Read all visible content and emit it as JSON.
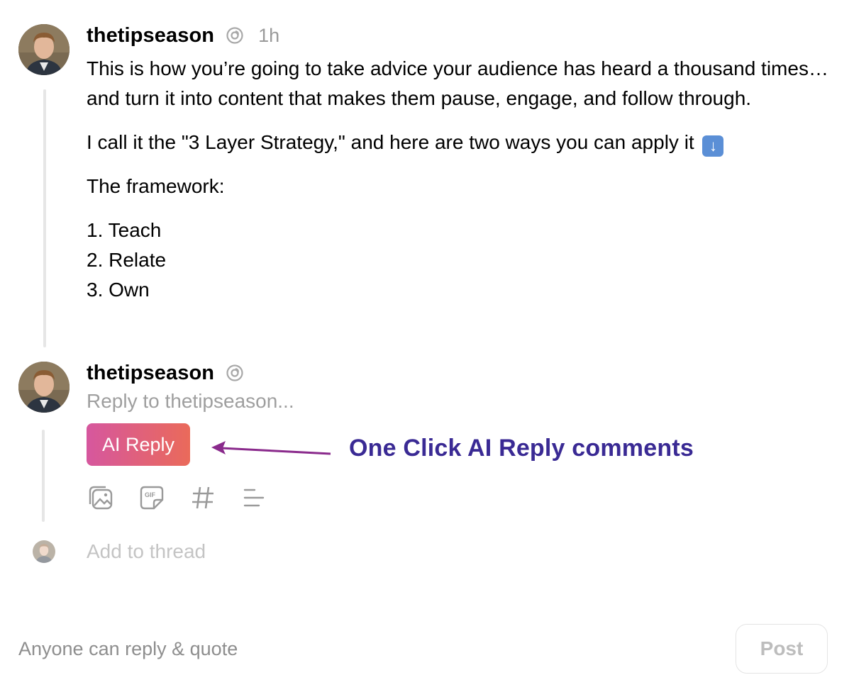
{
  "post": {
    "username": "thetipseason",
    "time": "1h",
    "paragraph1": "This is how you’re going to take advice your audience has heard a thousand times… and turn it into content that makes them pause, engage, and follow through.",
    "paragraph2": "I call it the \"3 Layer Strategy,\" and here are two ways you can apply it",
    "paragraph2_emoji": "⬇️",
    "paragraph3": "The framework:",
    "list": [
      "1. Teach",
      "2. Relate",
      "3. Own"
    ]
  },
  "reply": {
    "username": "thetipseason",
    "placeholder": "Reply to thetipseason...",
    "ai_button": "AI Reply",
    "annotation": "One Click AI Reply comments",
    "tools": [
      "image-icon",
      "gif-icon",
      "hashtag-icon",
      "text-format-icon"
    ],
    "gif_label": "GIF"
  },
  "thread": {
    "placeholder": "Add to thread"
  },
  "footer": {
    "reply_setting": "Anyone can reply & quote",
    "post_button": "Post"
  },
  "colors": {
    "annotation": "#3a2a94",
    "arrow": "#8a2a8c",
    "ai_gradient_start": "#d6579e",
    "ai_gradient_end": "#ea6a5a"
  }
}
